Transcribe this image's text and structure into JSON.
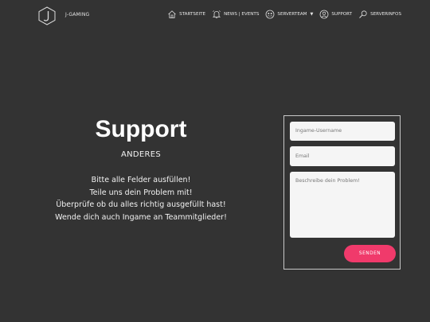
{
  "brand": {
    "name": "J-GAMING",
    "logo_icon": "j-hexagon-logo-icon"
  },
  "nav": {
    "items": [
      {
        "label": "STARTSEITE",
        "icon": "home-icon"
      },
      {
        "label": "NEWS | EVENTS",
        "icon": "bell-icon"
      },
      {
        "label": "SERVERTEAM",
        "icon": "team-icon",
        "has_dropdown": true
      },
      {
        "label": "SUPPORT",
        "icon": "user-circle-icon"
      },
      {
        "label": "SERVERINFOS",
        "icon": "search-icon"
      }
    ]
  },
  "support": {
    "title": "Support",
    "subtitle": "ANDERES",
    "lines": [
      "Bitte alle Felder ausfüllen!",
      "Teile uns dein Problem mit!",
      "Überprüfe ob du alles richtig ausgefüllt hast!",
      "Wende dich auch Ingame an Teammitglieder!"
    ]
  },
  "form": {
    "username_placeholder": "Ingame-Username",
    "email_placeholder": "Email",
    "problem_placeholder": "Beschreibe dein Problem!",
    "send_label": "SENDEN"
  },
  "colors": {
    "background": "#333333",
    "accent": "#f03a6b",
    "field_bg": "#f5f5f5"
  }
}
